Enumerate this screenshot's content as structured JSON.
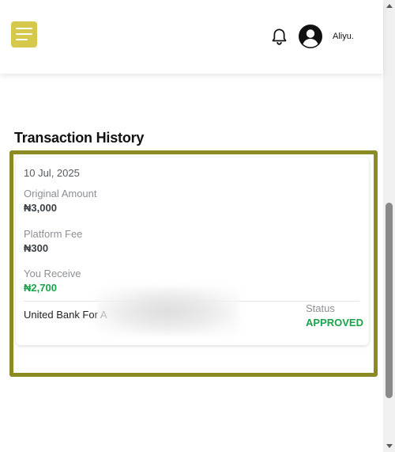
{
  "header": {
    "menu_icon": "hamburger-menu-icon",
    "notification_icon": "bell-icon",
    "avatar_icon": "user-avatar-icon",
    "user_name": "Aliyu.",
    "accent_color": "#d6c84a"
  },
  "section": {
    "title": "Transaction History"
  },
  "transaction": {
    "date": "10 Jul, 2025",
    "original_amount_label": "Original Amount",
    "original_amount": "₦3,000",
    "platform_fee_label": "Platform Fee",
    "platform_fee": "₦300",
    "you_receive_label": "You Receive",
    "you_receive": "₦2,700",
    "bank": "United Bank For A",
    "status_label": "Status",
    "status": "APPROVED",
    "status_color": "#1aa34a"
  },
  "frame_color": "#8c8a22"
}
